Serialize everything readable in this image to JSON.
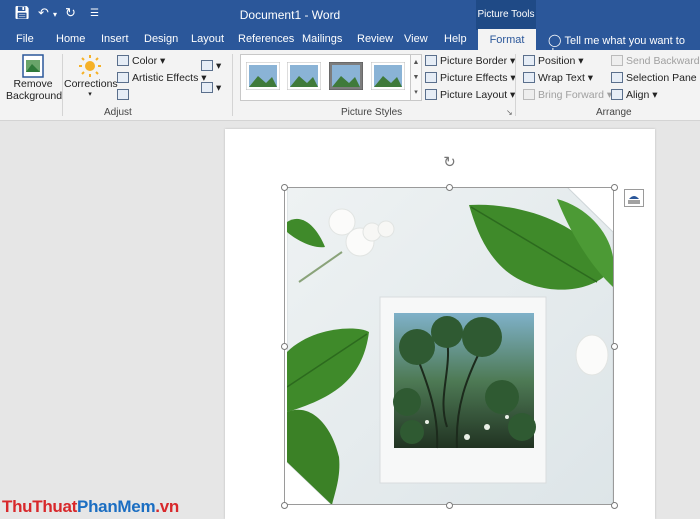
{
  "window": {
    "title": "Document1 - Word",
    "context_tools": "Picture Tools"
  },
  "tabs": [
    "File",
    "Home",
    "Insert",
    "Design",
    "Layout",
    "References",
    "Mailings",
    "Review",
    "View",
    "Help"
  ],
  "active_tab": "Format",
  "tell_me": "Tell me what you want to do",
  "adjust": {
    "remove_bg": [
      "Remove",
      "Background"
    ],
    "corrections": "Corrections",
    "color": "Color",
    "artistic": "Artistic Effects",
    "label": "Adjust"
  },
  "styles": {
    "label": "Picture Styles",
    "border": "Picture Border",
    "effects": "Picture Effects",
    "layout": "Picture Layout"
  },
  "arrange": {
    "label": "Arrange",
    "position": "Position",
    "wrap": "Wrap Text",
    "bring": "Bring Forward",
    "send": "Send Backward",
    "selection": "Selection Pane",
    "align": "Align"
  },
  "watermark": {
    "a": "Thu",
    "b": "Thuat",
    "c": "Phan",
    "d": "Mem",
    "e": ".vn"
  },
  "colors": {
    "accent": "#2b579a",
    "leaf": "#3f8a2a",
    "watermark_red": "#d8282b"
  }
}
